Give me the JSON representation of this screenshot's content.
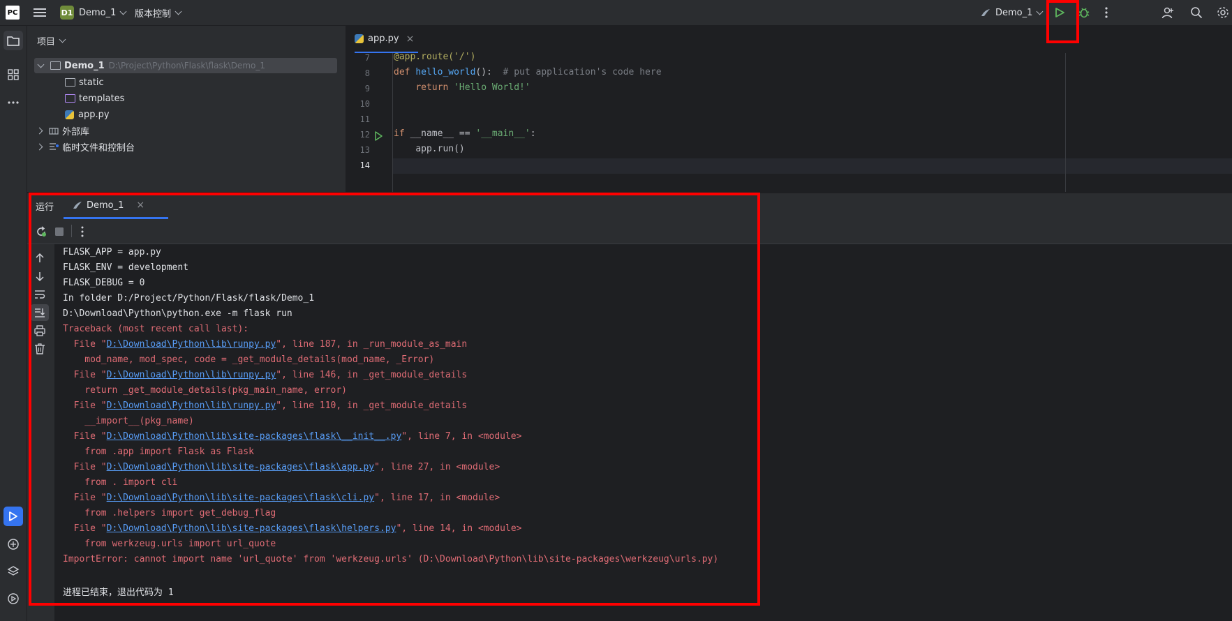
{
  "titlebar": {
    "logo": "PC",
    "project_badge": "D1",
    "project_name": "Demo_1",
    "vcs_label": "版本控制",
    "run_config": "Demo_1"
  },
  "project_panel": {
    "title": "项目",
    "root_name": "Demo_1",
    "root_path": "D:\\Project\\Python\\Flask\\flask\\Demo_1",
    "items": [
      {
        "label": "static",
        "icon": "folder-icon"
      },
      {
        "label": "templates",
        "icon": "folder-icon"
      },
      {
        "label": "app.py",
        "icon": "python-file-icon"
      }
    ],
    "external_libs": "外部库",
    "scratches": "临时文件和控制台"
  },
  "editor": {
    "tab_label": "app.py",
    "line_numbers": [
      "7",
      "8",
      "9",
      "10",
      "11",
      "12",
      "13",
      "14"
    ],
    "lines": {
      "l7_dec": "@app.route('/')",
      "l8_def": "def",
      "l8_fn": "hello_world",
      "l8_rest": "():  ",
      "l8_comment": "# put application's code here",
      "l9_ret": "return",
      "l9_str": "'Hello World!'",
      "l12_if": "if",
      "l12_mid": " __name__ == ",
      "l12_str": "'__main__'",
      "l12_end": ":",
      "l13": "app.run()"
    }
  },
  "run_panel": {
    "title": "运行",
    "tab_label": "Demo_1",
    "console": {
      "env_lines": [
        "FLASK_APP = app.py",
        "FLASK_ENV = development",
        "FLASK_DEBUG = 0",
        "In folder D:/Project/Python/Flask/flask/Demo_1",
        "D:\\Download\\Python\\python.exe -m flask run"
      ],
      "traceback_header": "Traceback (most recent call last):",
      "frames": [
        {
          "pre": "  File \"",
          "link": "D:\\Download\\Python\\lib\\runpy.py",
          "post": "\", line 187, in _run_module_as_main",
          "code": "    mod_name, mod_spec, code = _get_module_details(mod_name, _Error)"
        },
        {
          "pre": "  File \"",
          "link": "D:\\Download\\Python\\lib\\runpy.py",
          "post": "\", line 146, in _get_module_details",
          "code": "    return _get_module_details(pkg_main_name, error)"
        },
        {
          "pre": "  File \"",
          "link": "D:\\Download\\Python\\lib\\runpy.py",
          "post": "\", line 110, in _get_module_details",
          "code": "    __import__(pkg_name)"
        },
        {
          "pre": "  File \"",
          "link": "D:\\Download\\Python\\lib\\site-packages\\flask\\__init__.py",
          "post": "\", line 7, in <module>",
          "code": "    from .app import Flask as Flask"
        },
        {
          "pre": "  File \"",
          "link": "D:\\Download\\Python\\lib\\site-packages\\flask\\app.py",
          "post": "\", line 27, in <module>",
          "code": "    from . import cli"
        },
        {
          "pre": "  File \"",
          "link": "D:\\Download\\Python\\lib\\site-packages\\flask\\cli.py",
          "post": "\", line 17, in <module>",
          "code": "    from .helpers import get_debug_flag"
        },
        {
          "pre": "  File \"",
          "link": "D:\\Download\\Python\\lib\\site-packages\\flask\\helpers.py",
          "post": "\", line 14, in <module>",
          "code": "    from werkzeug.urls import url_quote"
        }
      ],
      "error_line": "ImportError: cannot import name 'url_quote' from 'werkzeug.urls' (D:\\Download\\Python\\lib\\site-packages\\werkzeug\\urls.py)",
      "exit_line": "进程已结束，退出代码为 1"
    }
  },
  "colors": {
    "highlight_box": "#ff0000",
    "error_text": "#e06c75",
    "link": "#589df6",
    "run_green": "#5fb85f"
  }
}
